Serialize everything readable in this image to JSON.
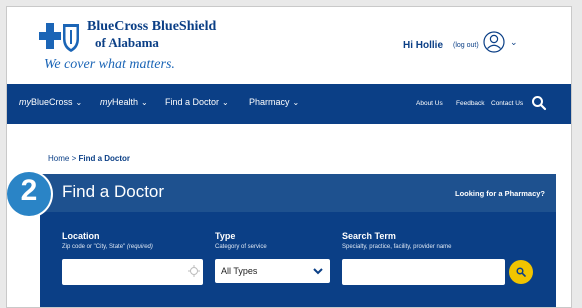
{
  "brand": {
    "line1": "BlueCross BlueShield",
    "line2": "of Alabama",
    "tagline": "We cover what matters."
  },
  "account": {
    "greeting": "Hi Hollie",
    "logout": "(log out)"
  },
  "nav": {
    "items": [
      {
        "prefix": "my",
        "label": "BlueCross"
      },
      {
        "prefix": "my",
        "label": "Health"
      },
      {
        "prefix": "",
        "label": "Find a Doctor"
      },
      {
        "prefix": "",
        "label": "Pharmacy"
      }
    ],
    "links": [
      "About Us",
      "Feedback",
      "Contact Us"
    ]
  },
  "breadcrumb": {
    "home": "Home",
    "separator": " > ",
    "current": "Find a Doctor"
  },
  "step": "2",
  "panel": {
    "title": "Find a Doctor",
    "pharmacy_link": "Looking for a Pharmacy?",
    "location": {
      "label": "Location",
      "hint": "Zip code or \"City, State\"",
      "required": "(required)",
      "value": ""
    },
    "type": {
      "label": "Type",
      "hint": "Category of service",
      "selected": "All Types"
    },
    "search": {
      "label": "Search Term",
      "hint": "Specialty, practice, facility, provider name",
      "value": ""
    }
  },
  "colors": {
    "navy": "#0b3f86",
    "panel_top": "#1e518f",
    "accent_yellow": "#f1c400",
    "badge_blue": "#2a84c6"
  },
  "icons": {
    "logo": "bcbs-cross-shield-logo",
    "user": "user-icon",
    "search": "search-icon",
    "location": "target-location-icon",
    "select": "chevron-down-icon"
  }
}
